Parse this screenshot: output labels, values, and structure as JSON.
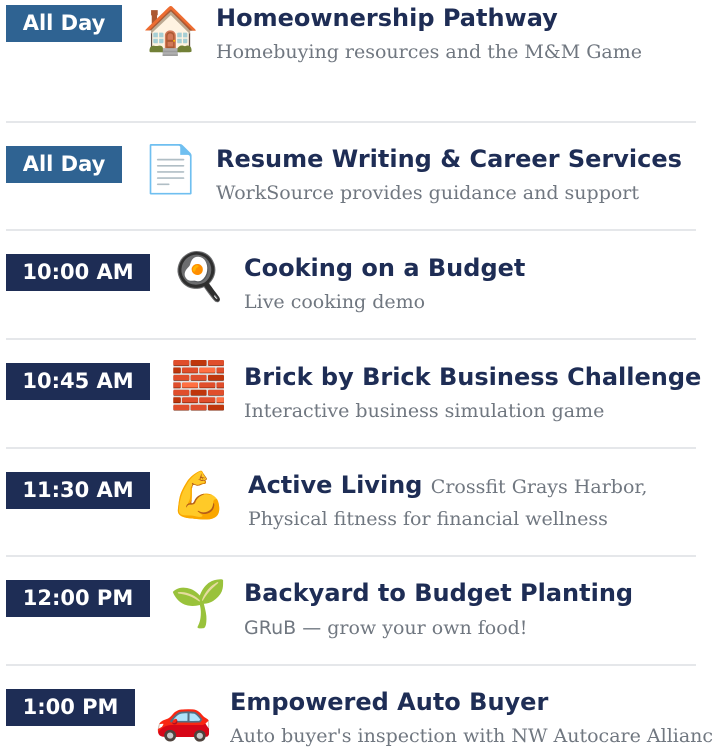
{
  "colors": {
    "badge_allday": "#2f6392",
    "badge_time": "#1e2d55",
    "title": "#1e2d55",
    "subtitle": "#707780"
  },
  "events": [
    {
      "time": "All Day",
      "icon": "house-icon",
      "icon_glyph": "🏠",
      "title": "Homeownership Pathway",
      "subtitle": "Homebuying resources and the M&M Game"
    },
    {
      "time": "All Day",
      "icon": "document-icon",
      "icon_glyph": "📄",
      "title": "Resume Writing & Career Services",
      "subtitle": "WorkSource provides guidance and support"
    },
    {
      "time": "10:00 AM",
      "icon": "frying-pan-egg-icon",
      "icon_glyph": "🍳",
      "title": "Cooking on a Budget",
      "subtitle": "Live cooking demo"
    },
    {
      "time": "10:45 AM",
      "icon": "brick-icon",
      "icon_glyph": "🧱",
      "title": "Brick by Brick Business Challenge",
      "subtitle": "Interactive business simulation game"
    },
    {
      "time": "11:30 AM",
      "icon": "flexed-bicep-icon",
      "icon_glyph": "💪",
      "title": "Active Living",
      "title_aside": "Crossfit Grays Harbor,",
      "subtitle": "Physical fitness for financial wellness"
    },
    {
      "time": "12:00 PM",
      "icon": "seedling-icon",
      "icon_glyph": "🌱",
      "title": "Backyard to Budget Planting",
      "subtitle_org": "GRuB —",
      "subtitle": "grow your own food!"
    },
    {
      "time": "1:00 PM",
      "icon": "car-icon",
      "icon_glyph": "🚗",
      "title": "Empowered Auto Buyer",
      "subtitle": "Auto buyer's inspection with NW Autocare Alliance"
    }
  ]
}
